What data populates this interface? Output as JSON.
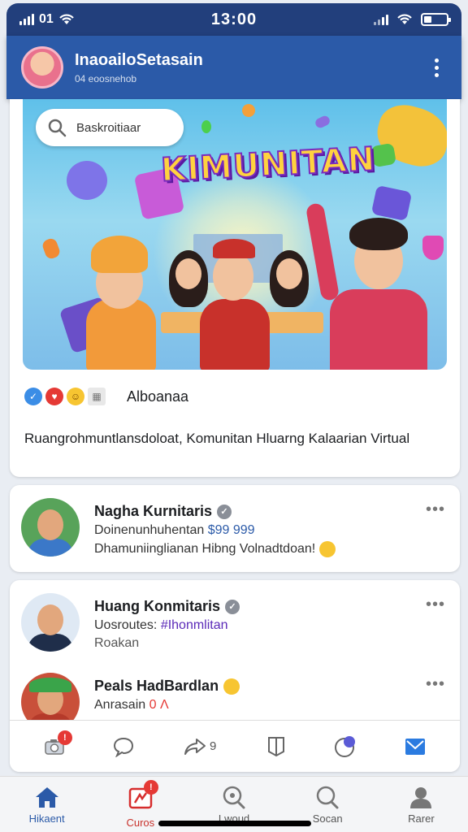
{
  "status_bar": {
    "carrier": "01",
    "time": "13:00"
  },
  "header": {
    "title": "InaoailoSetasain",
    "subtitle": "04 eoosnehob"
  },
  "hero": {
    "search_text": "Baskroitiaar",
    "banner_title": "KIMUNITAN",
    "reaction_label": "Alboanaa",
    "description": "Ruangrohmuntlansdoloat, Komunitan Hluarng Kalaarian Virtual"
  },
  "comments": [
    {
      "name": "Nagha Kurnitaris",
      "line1_prefix": "Doinenunhuhentan ",
      "line1_highlight": "$99 999",
      "line2": "Dhamuniinglianan Hibng Volnadtdoan!"
    },
    {
      "name": "Huang Konmitaris",
      "line1_prefix": "Uosroutes: ",
      "line1_highlight": "#Ihonmlitan",
      "line2": "Roakan"
    },
    {
      "name": "Peals HadBardlan",
      "line1_prefix": "Anrasain ",
      "line1_highlight": "0 Λ",
      "line2": ""
    }
  ],
  "actions": {
    "share_count": "9",
    "camera_badge": "!"
  },
  "tabs": [
    {
      "label": "Hikaent",
      "icon": "home-icon"
    },
    {
      "label": "Curos",
      "icon": "gift-icon",
      "badge": "!"
    },
    {
      "label": "Lwoud",
      "icon": "search-icon"
    },
    {
      "label": "Socan",
      "icon": "search-icon"
    },
    {
      "label": "Rarer",
      "icon": "profile-icon"
    }
  ],
  "colors": {
    "header": "#2b5aa8",
    "status": "#223f7c",
    "badge": "#e53935"
  }
}
